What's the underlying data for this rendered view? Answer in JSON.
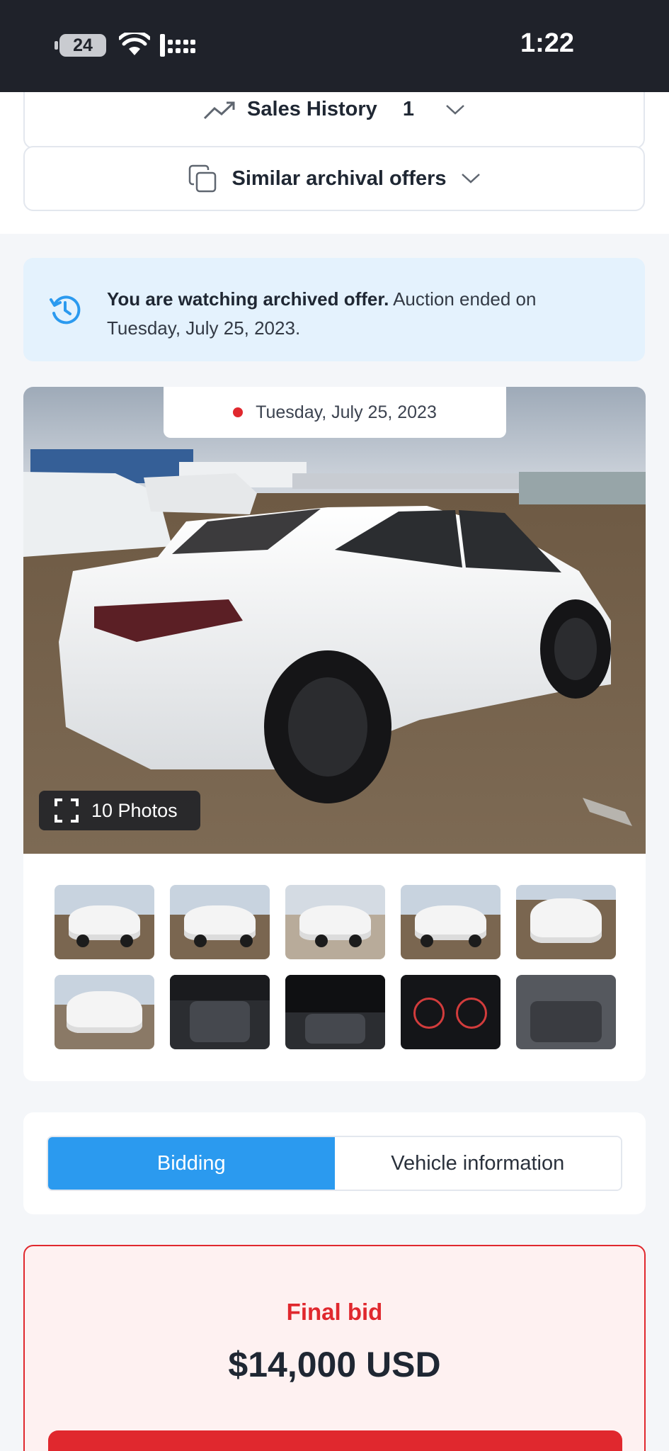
{
  "status_bar": {
    "battery": "24",
    "time": "1:22"
  },
  "sections": {
    "sales_history_label": "Sales History",
    "sales_history_count": "1",
    "similar_offers_label": "Similar archival offers"
  },
  "archive_notice": {
    "bold": "You are watching archived offer.",
    "rest": " Auction ended on Tuesday, July 25, 2023."
  },
  "gallery": {
    "date": "Tuesday, July 25, 2023",
    "photos_button": "10 Photos",
    "thumbnails": [
      "front-damage",
      "side-rear",
      "rear-three-quarter",
      "front-side",
      "front",
      "rear",
      "interior-front",
      "dashboard",
      "gauges",
      "rear-seats"
    ]
  },
  "tabs": {
    "bidding": "Bidding",
    "vehicle_info": "Vehicle information",
    "active": "Bidding"
  },
  "final_bid": {
    "label": "Final bid",
    "value": "$14,000 USD"
  },
  "colors": {
    "accent_blue": "#2b9aef",
    "alert_red": "#e0282e",
    "info_bg": "#e4f2fd"
  }
}
